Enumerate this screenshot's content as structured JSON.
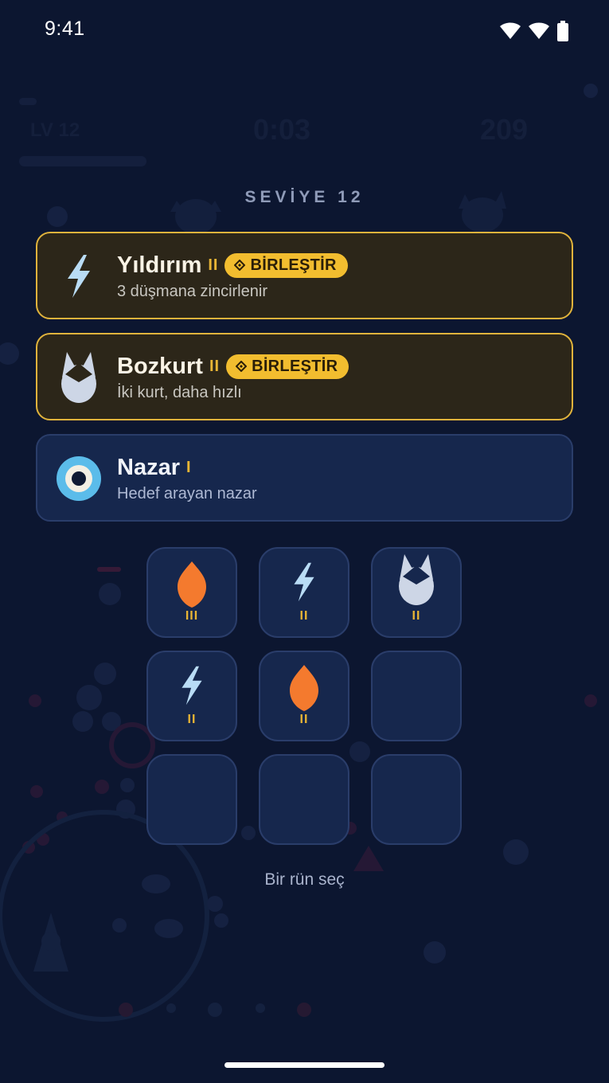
{
  "status_bar": {
    "time": "9:41"
  },
  "background_hud": {
    "level": "LV 12",
    "timer": "0:03",
    "score": "209"
  },
  "level_title": "SEVİYE 12",
  "options": [
    {
      "name": "Yıldırım",
      "tier": "II",
      "badge": "BİRLEŞTİR",
      "description": "3 düşmana zincirlenir",
      "icon": "lightning-icon",
      "style": "merge"
    },
    {
      "name": "Bozkurt",
      "tier": "II",
      "badge": "BİRLEŞTİR",
      "description": "İki kurt, daha hızlı",
      "icon": "wolf-icon",
      "style": "merge"
    },
    {
      "name": "Nazar",
      "tier": "I",
      "description": "Hedef arayan nazar",
      "icon": "evil-eye-icon",
      "style": "new"
    }
  ],
  "inventory": [
    {
      "icon": "flame-icon",
      "tier": "III"
    },
    {
      "icon": "lightning-icon",
      "tier": "II"
    },
    {
      "icon": "wolf-icon",
      "tier": "II"
    },
    {
      "icon": "lightning-icon",
      "tier": "II"
    },
    {
      "icon": "flame-icon",
      "tier": "II"
    },
    {
      "icon": "",
      "tier": ""
    },
    {
      "icon": "",
      "tier": ""
    },
    {
      "icon": "",
      "tier": ""
    },
    {
      "icon": "",
      "tier": ""
    }
  ],
  "hint": "Bir rün seç",
  "colors": {
    "background": "#0c1630",
    "gold": "#e0b33c",
    "badge": "#f2bd2f",
    "flame": "#f47a2e",
    "lightning": "#b9dcf5",
    "wolf": "#cdd6e6",
    "eye_outer": "#5bbcea"
  }
}
